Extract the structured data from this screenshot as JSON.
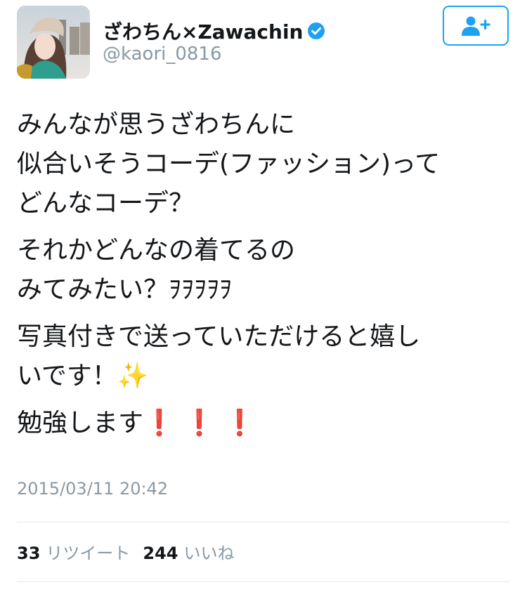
{
  "author": {
    "display_name": "ざわちん×Zawachin",
    "handle": "@kaori_0816",
    "verified": true,
    "avatar": "profile-photo"
  },
  "follow_button": {
    "icon": "add-user-icon",
    "color": "#1da1f2"
  },
  "tweet": {
    "paragraphs": [
      [
        "みんなが思うざわちんに",
        "似合いそうコーデ(ファッション)って",
        "どんなコーデ？"
      ],
      [
        "それかどんなの着てるの",
        "みてみたい？ｦｦｦｦｦ"
      ],
      [
        "写真付きで送っていただけると嬉し",
        "いです！"
      ],
      [
        "勉強します"
      ]
    ],
    "sparkle_emoji": "✨",
    "exclamation_emoji": "❗ ❗ ❗",
    "timestamp": "2015/03/11 20:42"
  },
  "stats": {
    "retweets_count": "33",
    "retweets_label": "リツイート",
    "likes_count": "244",
    "likes_label": "いいね"
  },
  "colors": {
    "text": "#14171a",
    "secondary": "#8899a6",
    "accent": "#1da1f2",
    "divider": "#e1e8ed"
  }
}
